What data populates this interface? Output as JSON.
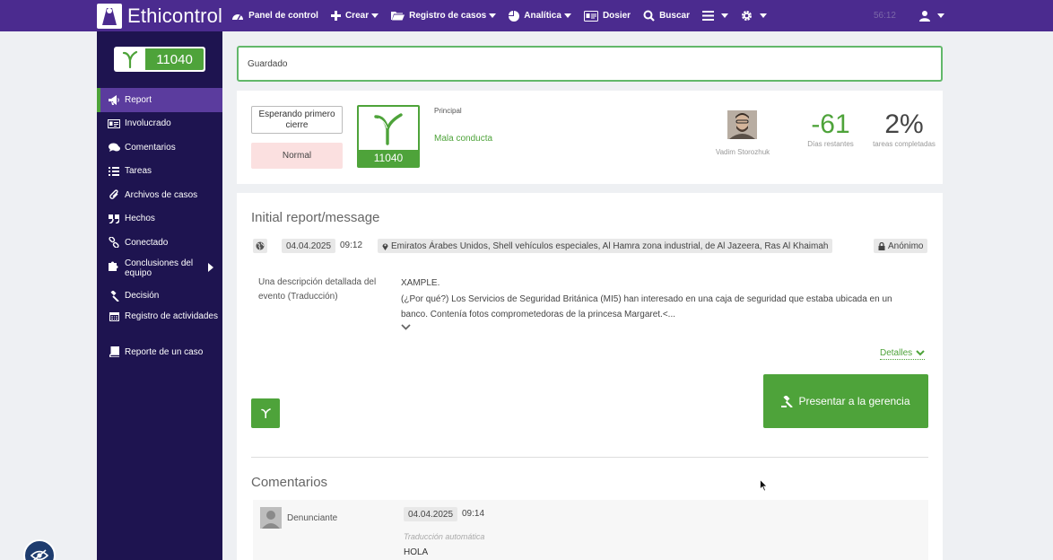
{
  "app": {
    "name": "Ethicontrol",
    "clock": "56:12"
  },
  "nav": {
    "items": [
      {
        "label": "Panel de control",
        "icon": "dashboard-icon"
      },
      {
        "label": "Crear",
        "icon": "plus-icon"
      },
      {
        "label": "Registro de casos",
        "icon": "folder-icon"
      },
      {
        "label": "Analítica",
        "icon": "pie-chart-icon"
      },
      {
        "label": "Dosier",
        "icon": "id-card-icon"
      },
      {
        "label": "Buscar",
        "icon": "search-icon"
      }
    ]
  },
  "case": {
    "number": "11040"
  },
  "sidebar": {
    "items": [
      {
        "label": "Report",
        "icon": "megaphone-icon"
      },
      {
        "label": "Involucrado",
        "icon": "id-card-icon"
      },
      {
        "label": "Comentarios",
        "icon": "comments-icon"
      },
      {
        "label": "Tareas",
        "icon": "list-icon"
      },
      {
        "label": "Archivos de casos",
        "icon": "paperclip-icon"
      },
      {
        "label": "Hechos",
        "icon": "quote-icon"
      },
      {
        "label": "Conectado",
        "icon": "link-icon"
      },
      {
        "label": "Conclusiones del equipo",
        "icon": "puzzle-icon"
      },
      {
        "label": "Decisión",
        "icon": "gavel-icon"
      },
      {
        "label": "Registro de actividades",
        "icon": "calendar-icon"
      },
      {
        "label": "Reporte de un caso",
        "icon": "book-icon"
      }
    ]
  },
  "alert": {
    "text": "Guardado"
  },
  "summary": {
    "status": "Esperando primero cierre",
    "priority": "Normal",
    "principal_label": "Principal",
    "principal_value": "Mala conducta",
    "assignee": "Vadim Storozhuk",
    "days_value": "-61",
    "days_label": "Días restantes",
    "tasks_value": "2%",
    "tasks_label": "tareas completadas"
  },
  "report": {
    "title": "Initial report/message",
    "date": "04.04.2025",
    "time": "09:12",
    "location": "Emiratos Árabes Unidos, Shell vehículos especiales, Al Hamra zona industrial, de Al Jazeera, Ras Al Khaimah",
    "anonymous": "Anónimo",
    "desc_label": "Una descripción detallada del evento (Traducción)",
    "desc_line1": "XAMPLE.",
    "desc_line2": "(¿Por qué?) Los Servicios de Seguridad Británica (MI5) han interesado en una caja de seguridad que estaba ubicada en un banco. Contenía fotos comprometedoras de la princesa Margaret.<...",
    "details_label": "Detalles",
    "present_button": "Presentar a la gerencia"
  },
  "comments": {
    "title": "Comentarios",
    "items": [
      {
        "author": "Denunciante",
        "date": "04.04.2025",
        "time": "09:14",
        "note": "Traducción automática",
        "text": "HOLA"
      }
    ]
  },
  "colors": {
    "nav": "#4b2b8f",
    "sidebar": "#1e1450",
    "accent": "#4ea33a"
  }
}
